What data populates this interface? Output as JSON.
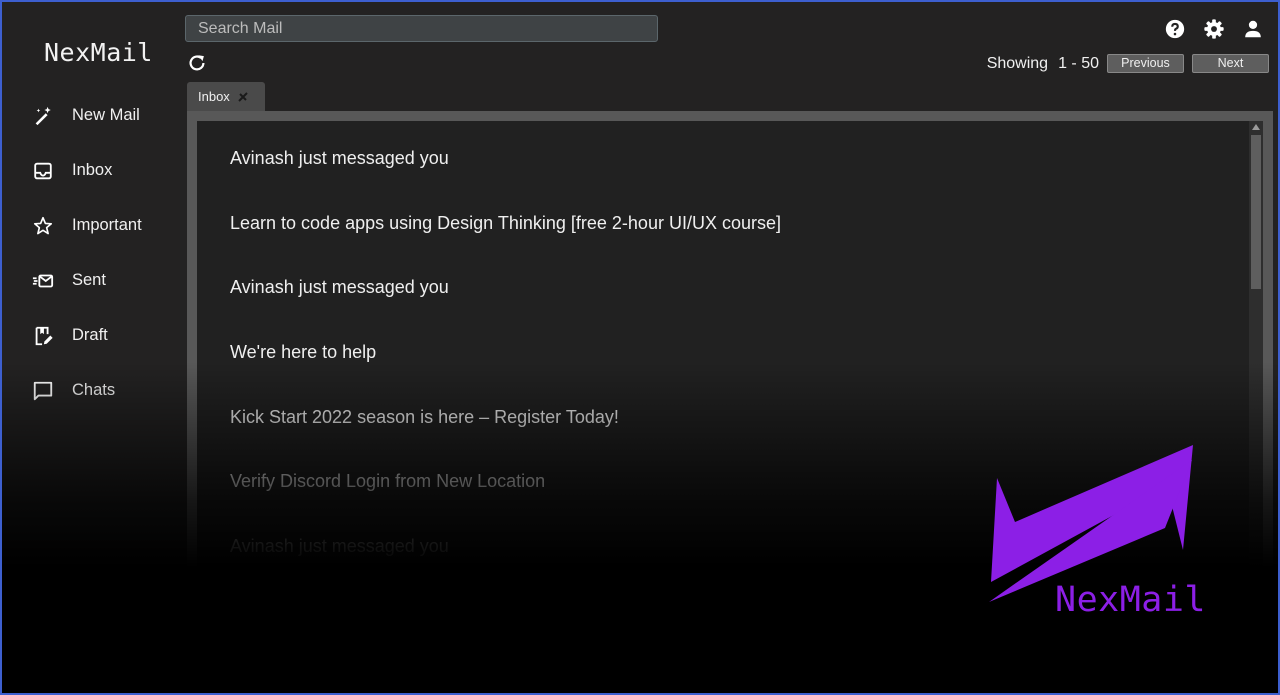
{
  "app": {
    "logo_text": "NexMail"
  },
  "search": {
    "placeholder": "Search Mail"
  },
  "sidebar": {
    "items": [
      {
        "label": "New Mail",
        "icon": "edit-magic-icon"
      },
      {
        "label": "Inbox",
        "icon": "inbox-icon"
      },
      {
        "label": "Important",
        "icon": "star-icon"
      },
      {
        "label": "Sent",
        "icon": "sent-mail-icon"
      },
      {
        "label": "Draft",
        "icon": "draft-icon"
      },
      {
        "label": "Chats",
        "icon": "chat-icon"
      }
    ]
  },
  "pagination": {
    "showing_label": "Showing",
    "range": "1 - 50",
    "previous_label": "Previous",
    "next_label": "Next"
  },
  "tabs": [
    {
      "label": "Inbox"
    }
  ],
  "mails": [
    {
      "subject": "Avinash just messaged you"
    },
    {
      "subject": "Learn to code apps using Design Thinking [free 2-hour UI/UX course]"
    },
    {
      "subject": "Avinash just messaged you"
    },
    {
      "subject": "We're here to help"
    },
    {
      "subject": "Kick Start 2022 season is here – Register Today!"
    },
    {
      "subject": "Verify Discord Login from New Location"
    },
    {
      "subject": "Avinash just messaged you"
    }
  ],
  "brand_overlay": {
    "text": "NexMail",
    "color": "#8c1fe6"
  },
  "colors": {
    "accent": "#8c1fe6",
    "border": "#3d5fcf"
  }
}
